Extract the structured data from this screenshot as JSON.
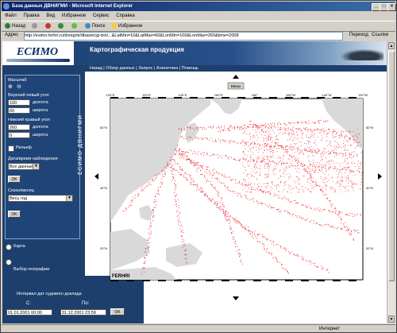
{
  "browser": {
    "title": "База данных ДВНИГМИ - Microsoft Internet Explorer",
    "menu": [
      "Файл",
      "Правка",
      "Вид",
      "Избранное",
      "Сервис",
      "Справка"
    ],
    "toolbar": [
      "Назад",
      "Поиск",
      "Избранное"
    ],
    "address_label": "Адрес",
    "address_value": "http://esimo.ferhri.ru/dvnigmi/dbase/cgi-bin/...&LatMin=10&LatMax=60&LonMin=100&LonMax=260&time=2008",
    "go_label": "Переход",
    "links_label": "Ссылки",
    "status_zone": "Интернет"
  },
  "page": {
    "logo_text": "ЕСИМО",
    "header_title": "Картографическая продукция",
    "nav_links": "Назад | Обзор данных | Запрос | Аналитика | Помощь",
    "vertical_label": "ЕСИМО ДВНИГМИ"
  },
  "sidebar": {
    "zoom_label": "Масштаб",
    "top_left_label": "Верхний левый угол",
    "lat_label": "долгота",
    "lon_label": "широта",
    "top_left_lon": "100",
    "top_left_lat": "60",
    "bottom_right_label": "Нижний правый угол",
    "bottom_right_lon": "260",
    "bottom_right_lat": "0",
    "relief_label": "Рельеф",
    "period_label": "Дата/время наблюдения",
    "period_value": "Все данные",
    "ok1": "OK",
    "season_label": "Сезон/месяц",
    "season_value": "Весь год",
    "ok2": "OK",
    "radio1": "Карта",
    "radio2": "Выбор географии"
  },
  "bottom": {
    "title": "Интервал дат судового доклада",
    "from_label": "С:",
    "to_label": "По:",
    "from_value": "01.01.2001 00:00",
    "to_value": "31.12.2001 23:59",
    "ok": "OK"
  },
  "map": {
    "top_button": "Вверх",
    "lon_ticks": [
      "100°E",
      "120°E",
      "140°E",
      "160°E",
      "180°",
      "160°W",
      "140°W",
      "120°W"
    ],
    "lat_ticks": [
      "60°N",
      "40°N",
      "20°N"
    ],
    "watermark": "FERHRI",
    "footnote": "© ГГИ"
  },
  "colors": {
    "header_bg": "#1d3f6d",
    "track": "#e8131a",
    "land": "#d9d9d9",
    "ocean": "#ffffff"
  }
}
